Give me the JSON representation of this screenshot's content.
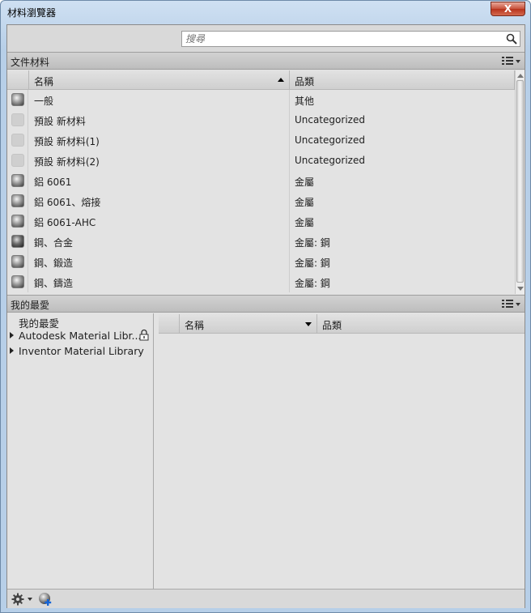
{
  "window": {
    "title": "材料瀏覽器",
    "close_label": "X"
  },
  "search": {
    "placeholder": "搜尋",
    "value": ""
  },
  "doc_materials": {
    "header": "文件材料",
    "columns": {
      "name": "名稱",
      "category": "品類"
    },
    "rows": [
      {
        "swatch": "metal",
        "name": "一般",
        "category": "其他"
      },
      {
        "swatch": "plain",
        "name": "預設 新材料",
        "category": "Uncategorized"
      },
      {
        "swatch": "plain",
        "name": "預設 新材料(1)",
        "category": "Uncategorized"
      },
      {
        "swatch": "plain",
        "name": "預設 新材料(2)",
        "category": "Uncategorized"
      },
      {
        "swatch": "metal",
        "name": "鋁 6061",
        "category": "金屬"
      },
      {
        "swatch": "metal",
        "name": "鋁 6061、熔接",
        "category": "金屬"
      },
      {
        "swatch": "metal",
        "name": "鋁 6061-AHC",
        "category": "金屬"
      },
      {
        "swatch": "dark",
        "name": "鋼、合金",
        "category": "金屬: 鋼"
      },
      {
        "swatch": "metal",
        "name": "鋼、鍛造",
        "category": "金屬: 鋼"
      },
      {
        "swatch": "metal",
        "name": "鋼、鑄造",
        "category": "金屬: 鋼"
      }
    ]
  },
  "favorites": {
    "header": "我的最愛",
    "tree": [
      {
        "label": "我的最愛",
        "expandable": false,
        "locked": false
      },
      {
        "label": "Autodesk Material Libr...",
        "expandable": true,
        "locked": true
      },
      {
        "label": "Inventor Material Library",
        "expandable": true,
        "locked": false
      }
    ],
    "columns": {
      "name": "名稱",
      "category": "品類"
    }
  },
  "icons": {
    "search": "search-icon",
    "view": "list-view-icon",
    "lock": "lock-icon",
    "gear": "gear-icon",
    "add_library": "add-library-icon"
  }
}
